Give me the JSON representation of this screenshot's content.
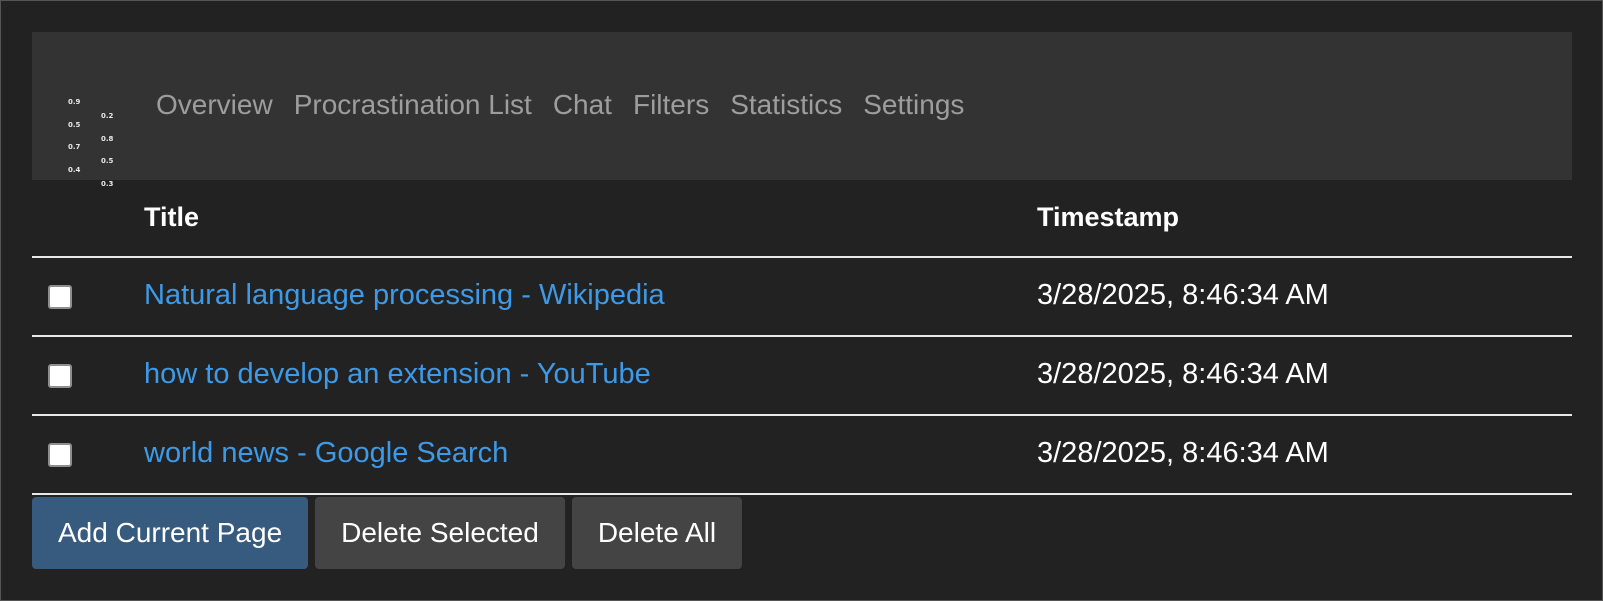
{
  "logo": {
    "icon": "chart-logo-icon",
    "col1": [
      "0.9",
      "0.5",
      "0.7",
      "0.4"
    ],
    "col2": [
      "0.2",
      "0.8",
      "0.5",
      "0.3"
    ]
  },
  "nav": {
    "items": [
      {
        "label": "Overview"
      },
      {
        "label": "Procrastination List"
      },
      {
        "label": "Chat"
      },
      {
        "label": "Filters"
      },
      {
        "label": "Statistics"
      },
      {
        "label": "Settings"
      }
    ]
  },
  "table": {
    "headers": {
      "title": "Title",
      "timestamp": "Timestamp"
    },
    "rows": [
      {
        "title": "Natural language processing - Wikipedia",
        "timestamp": "3/28/2025, 8:46:34 AM",
        "checked": false
      },
      {
        "title": "how to develop an extension - YouTube",
        "timestamp": "3/28/2025, 8:46:34 AM",
        "checked": false
      },
      {
        "title": "world news - Google Search",
        "timestamp": "3/28/2025, 8:46:34 AM",
        "checked": false
      }
    ]
  },
  "actions": {
    "add_label": "Add Current Page",
    "delete_selected_label": "Delete Selected",
    "delete_all_label": "Delete All"
  },
  "colors": {
    "background": "#222222",
    "navbar": "#333333",
    "link": "#3d9ae8",
    "primary": "#375a7f",
    "secondary": "#444444"
  }
}
